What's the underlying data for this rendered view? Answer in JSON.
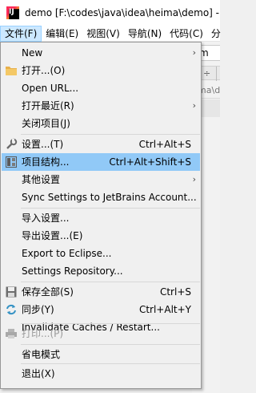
{
  "window": {
    "title": "demo [F:\\codes\\java\\idea\\heima\\demo] - ",
    "app_icon_letter": "IJ"
  },
  "menubar": [
    {
      "label": "文件(F)",
      "active": true
    },
    {
      "label": "编辑(E)"
    },
    {
      "label": "视图(V)"
    },
    {
      "label": "导航(N)"
    },
    {
      "label": "代码(C)"
    },
    {
      "label": "分"
    }
  ],
  "background": {
    "tab_text": "m",
    "path_text": "ima\\d"
  },
  "menu": {
    "items": [
      {
        "label": "New",
        "submenu": true
      },
      {
        "label": "打开...(O)",
        "icon": "folder-icon"
      },
      {
        "label": "Open URL..."
      },
      {
        "label": "打开最近(R)",
        "submenu": true
      },
      {
        "label": "关闭项目(J)"
      },
      {
        "label": "设置...(T)",
        "shortcut": "Ctrl+Alt+S",
        "icon": "wrench-icon"
      },
      {
        "label": "项目结构...",
        "shortcut": "Ctrl+Alt+Shift+S",
        "icon": "project-structure-icon",
        "highlight": true
      },
      {
        "label": "其他设置",
        "submenu": true
      },
      {
        "label": "Sync Settings to JetBrains Account..."
      },
      {
        "label": "导入设置..."
      },
      {
        "label": "导出设置...(E)"
      },
      {
        "label": "Export to Eclipse..."
      },
      {
        "label": "Settings Repository..."
      },
      {
        "label": "保存全部(S)",
        "shortcut": "Ctrl+S",
        "icon": "save-icon"
      },
      {
        "label": "同步(Y)",
        "shortcut": "Ctrl+Alt+Y",
        "icon": "sync-icon"
      },
      {
        "label": "Invalidate Caches / Restart..."
      },
      {
        "label": "打印...(P)",
        "icon": "print-icon",
        "disabled": true
      },
      {
        "label": "省电模式"
      },
      {
        "label": "退出(X)"
      }
    ]
  },
  "colors": {
    "highlight": "#91c9f7",
    "menu_bg": "#f0f0f0",
    "active_menubar": "#cce8ff",
    "disabled_text": "#9a9a9a"
  }
}
